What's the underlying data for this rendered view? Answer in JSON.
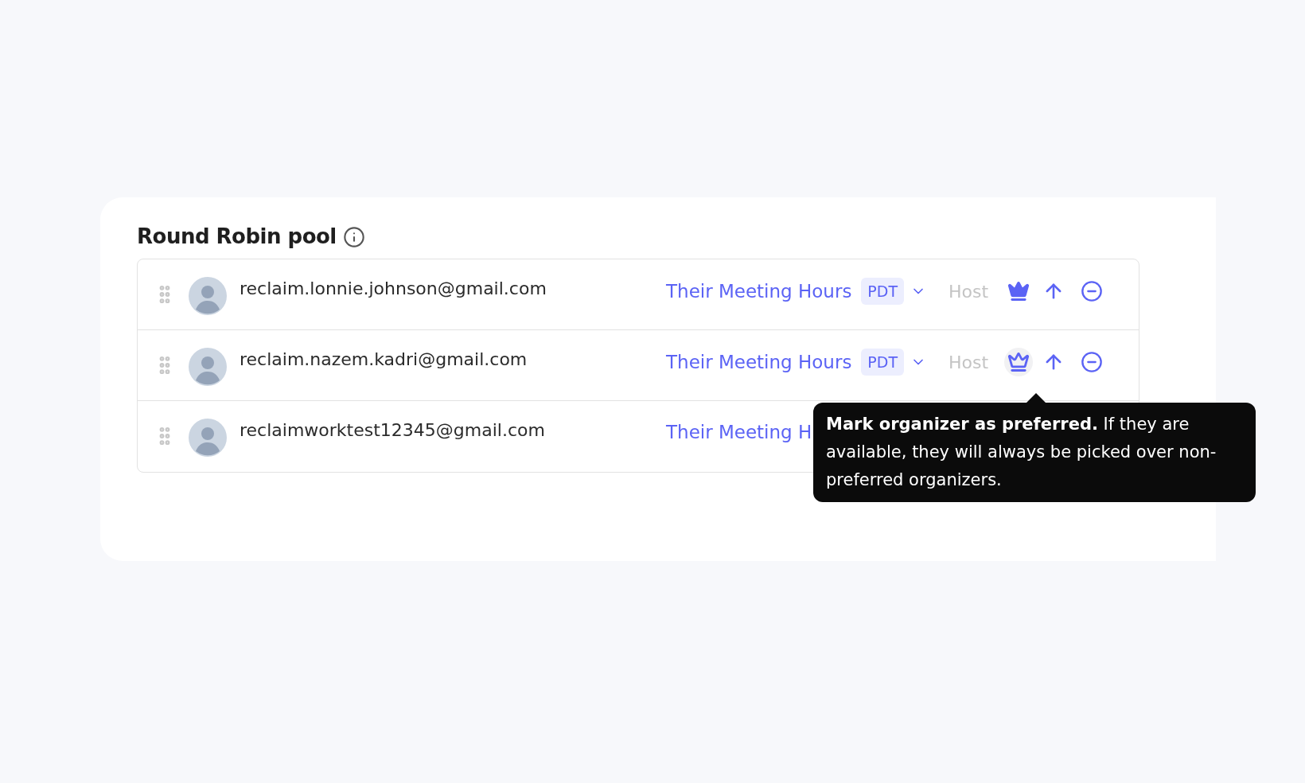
{
  "section": {
    "title": "Round Robin pool"
  },
  "members": [
    {
      "email": "reclaim.lonnie.johnson@gmail.com",
      "meeting_hours": "Their Meeting Hours",
      "timezone": "PDT",
      "role": "Host",
      "preferred": true,
      "hovered": false
    },
    {
      "email": "reclaim.nazem.kadri@gmail.com",
      "meeting_hours": "Their Meeting Hours",
      "timezone": "PDT",
      "role": "Host",
      "preferred": false,
      "hovered": true
    },
    {
      "email": "reclaimworktest12345@gmail.com",
      "meeting_hours": "Their Meeting H"
    }
  ],
  "tooltip": {
    "text": "**Mark organizer as preferred.** If they are available, they will always be picked over non-preferred organizers."
  }
}
